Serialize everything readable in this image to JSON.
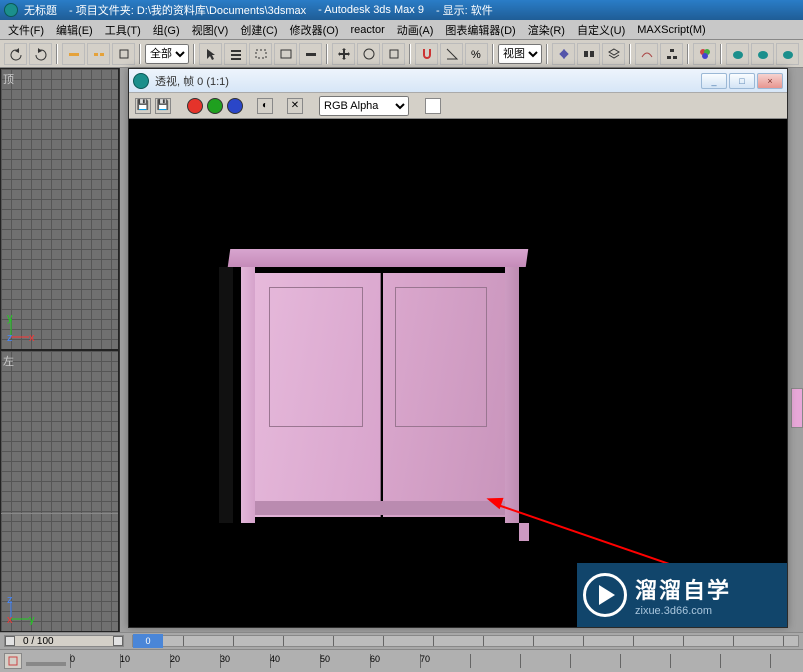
{
  "titlebar": {
    "doc_title": "无标题",
    "project_label": "- 项目文件夹: D:\\我的资料库\\Documents\\3dsmax",
    "app": "- Autodesk 3ds Max 9",
    "display": "- 显示: 软件"
  },
  "menu": {
    "file": "文件(F)",
    "edit": "编辑(E)",
    "tools": "工具(T)",
    "group": "组(G)",
    "views": "视图(V)",
    "create": "创建(C)",
    "modifiers": "修改器(O)",
    "reactor": "reactor",
    "animation": "动画(A)",
    "graph": "图表编辑器(D)",
    "render": "渲染(R)",
    "customize": "自定义(U)",
    "maxscript": "MAXScript(M)"
  },
  "toolbar": {
    "scope_select": "全部",
    "view_select": "视图"
  },
  "viewports": {
    "top_label": "顶",
    "left_label": "左",
    "axis": {
      "x": "x",
      "y": "y",
      "z": "z"
    }
  },
  "preview": {
    "title": "透视, 帧 0 (1:1)",
    "min": "_",
    "max": "□",
    "close": "×",
    "save": "💾",
    "save2": "💾",
    "dot": "●",
    "halfmoon": "◐",
    "x": "✕",
    "channel_select": "RGB Alpha",
    "swatch": "#ffffff"
  },
  "timeline": {
    "frame_display": "0 / 100",
    "frame0": "0",
    "ticks": [
      "0",
      "10",
      "20",
      "30",
      "40",
      "50",
      "60",
      "70"
    ]
  },
  "watermark": {
    "title": "溜溜自学",
    "url": "zixue.3d66.com"
  },
  "colors": {
    "red": "#e5332a",
    "green": "#1fa01f",
    "blue": "#2a46c8"
  }
}
